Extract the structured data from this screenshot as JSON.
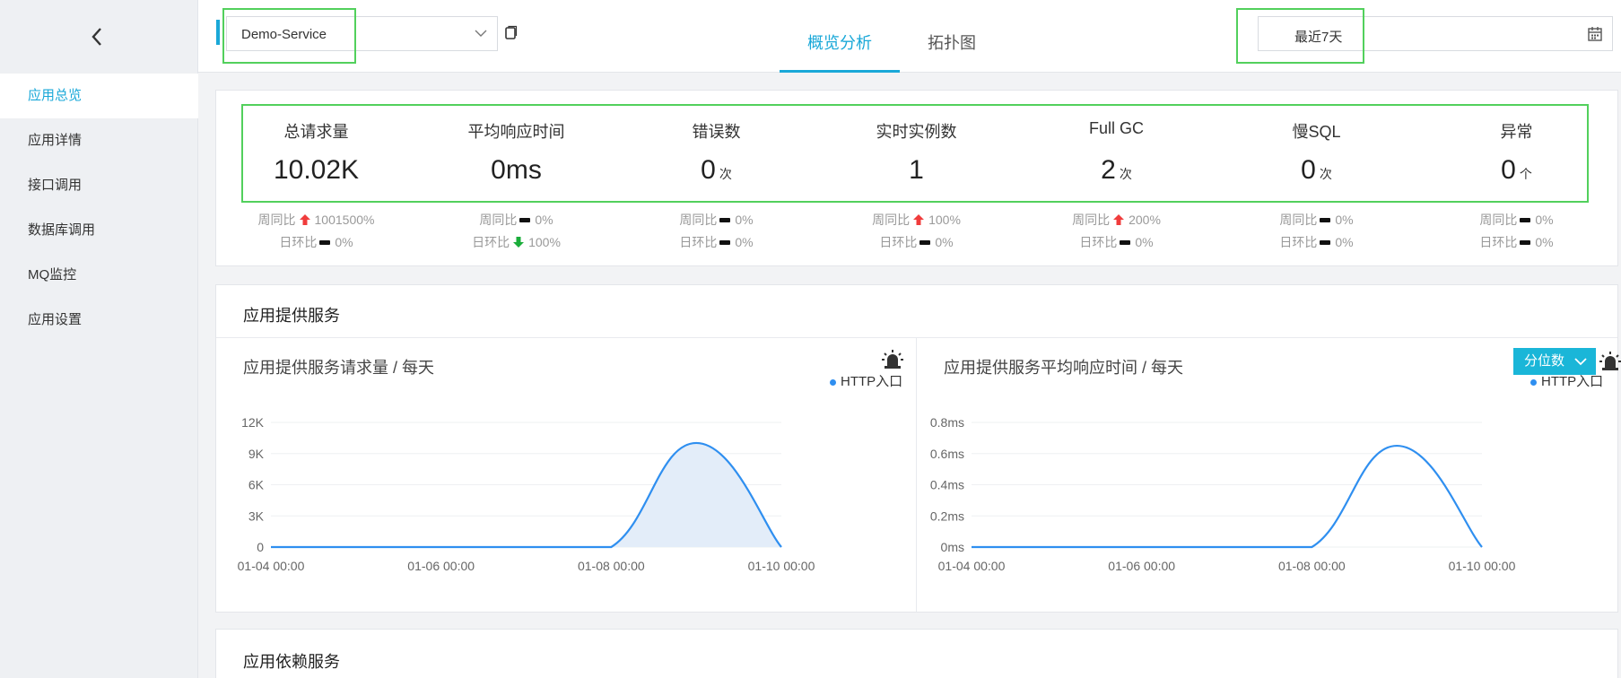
{
  "sidebar": {
    "items": [
      {
        "label": "应用总览",
        "active": true
      },
      {
        "label": "应用详情",
        "active": false
      },
      {
        "label": "接口调用",
        "active": false
      },
      {
        "label": "数据库调用",
        "active": false
      },
      {
        "label": "MQ监控",
        "active": false
      },
      {
        "label": "应用设置",
        "active": false
      }
    ]
  },
  "topbar": {
    "service": "Demo-Service",
    "tabs": [
      {
        "label": "概览分析",
        "active": true
      },
      {
        "label": "拓扑图",
        "active": false
      }
    ],
    "date_range": "最近7天"
  },
  "kpis": [
    {
      "label": "总请求量",
      "value": "10.02K",
      "unit": "",
      "wow_label": "周同比",
      "wow_trend": "up",
      "wow_value": "1001500%",
      "dod_label": "日环比",
      "dod_trend": "flat",
      "dod_value": "0%"
    },
    {
      "label": "平均响应时间",
      "value": "0ms",
      "unit": "",
      "wow_label": "周同比",
      "wow_trend": "flat",
      "wow_value": "0%",
      "dod_label": "日环比",
      "dod_trend": "down",
      "dod_value": "100%"
    },
    {
      "label": "错误数",
      "value": "0",
      "unit": "次",
      "wow_label": "周同比",
      "wow_trend": "flat",
      "wow_value": "0%",
      "dod_label": "日环比",
      "dod_trend": "flat",
      "dod_value": "0%"
    },
    {
      "label": "实时实例数",
      "value": "1",
      "unit": "",
      "wow_label": "周同比",
      "wow_trend": "up",
      "wow_value": "100%",
      "dod_label": "日环比",
      "dod_trend": "flat",
      "dod_value": "0%"
    },
    {
      "label": "Full GC",
      "value": "2",
      "unit": "次",
      "wow_label": "周同比",
      "wow_trend": "up",
      "wow_value": "200%",
      "dod_label": "日环比",
      "dod_trend": "flat",
      "dod_value": "0%"
    },
    {
      "label": "慢SQL",
      "value": "0",
      "unit": "次",
      "wow_label": "周同比",
      "wow_trend": "flat",
      "wow_value": "0%",
      "dod_label": "日环比",
      "dod_trend": "flat",
      "dod_value": "0%"
    },
    {
      "label": "异常",
      "value": "0",
      "unit": "个",
      "wow_label": "周同比",
      "wow_trend": "flat",
      "wow_value": "0%",
      "dod_label": "日环比",
      "dod_trend": "flat",
      "dod_value": "0%"
    }
  ],
  "provided_services": {
    "title": "应用提供服务",
    "quantile_button": "分位数"
  },
  "dependency_services": {
    "title": "应用依赖服务"
  },
  "colors": {
    "accent": "#1aa8d8",
    "series": "#2f8ff0",
    "up": "#f03c3c",
    "down": "#1aad3a",
    "highlight_box": "#52d05c"
  },
  "chart_data": [
    {
      "type": "area",
      "title": "应用提供服务请求量 / 每天",
      "legend": [
        "HTTP入口"
      ],
      "x_ticks": [
        "01-04 00:00",
        "01-06 00:00",
        "01-08 00:00",
        "01-10 00:00"
      ],
      "y_ticks": [
        "0",
        "3K",
        "6K",
        "9K",
        "12K"
      ],
      "ylim": [
        0,
        12000
      ],
      "series": [
        {
          "name": "HTTP入口",
          "x": [
            "01-04 00:00",
            "01-05 00:00",
            "01-06 00:00",
            "01-07 00:00",
            "01-08 00:00",
            "01-09 00:00",
            "01-10 00:00"
          ],
          "values": [
            0,
            0,
            0,
            0,
            0,
            10020,
            0
          ]
        }
      ]
    },
    {
      "type": "line",
      "title": "应用提供服务平均响应时间 / 每天",
      "legend": [
        "HTTP入口"
      ],
      "x_ticks": [
        "01-04 00:00",
        "01-06 00:00",
        "01-08 00:00",
        "01-10 00:00"
      ],
      "y_ticks": [
        "0ms",
        "0.2ms",
        "0.4ms",
        "0.6ms",
        "0.8ms"
      ],
      "ylim": [
        0,
        0.8
      ],
      "series": [
        {
          "name": "HTTP入口",
          "x": [
            "01-04 00:00",
            "01-05 00:00",
            "01-06 00:00",
            "01-07 00:00",
            "01-08 00:00",
            "01-09 00:00",
            "01-10 00:00"
          ],
          "values": [
            0,
            0,
            0,
            0,
            0,
            0.65,
            0
          ]
        }
      ]
    }
  ]
}
